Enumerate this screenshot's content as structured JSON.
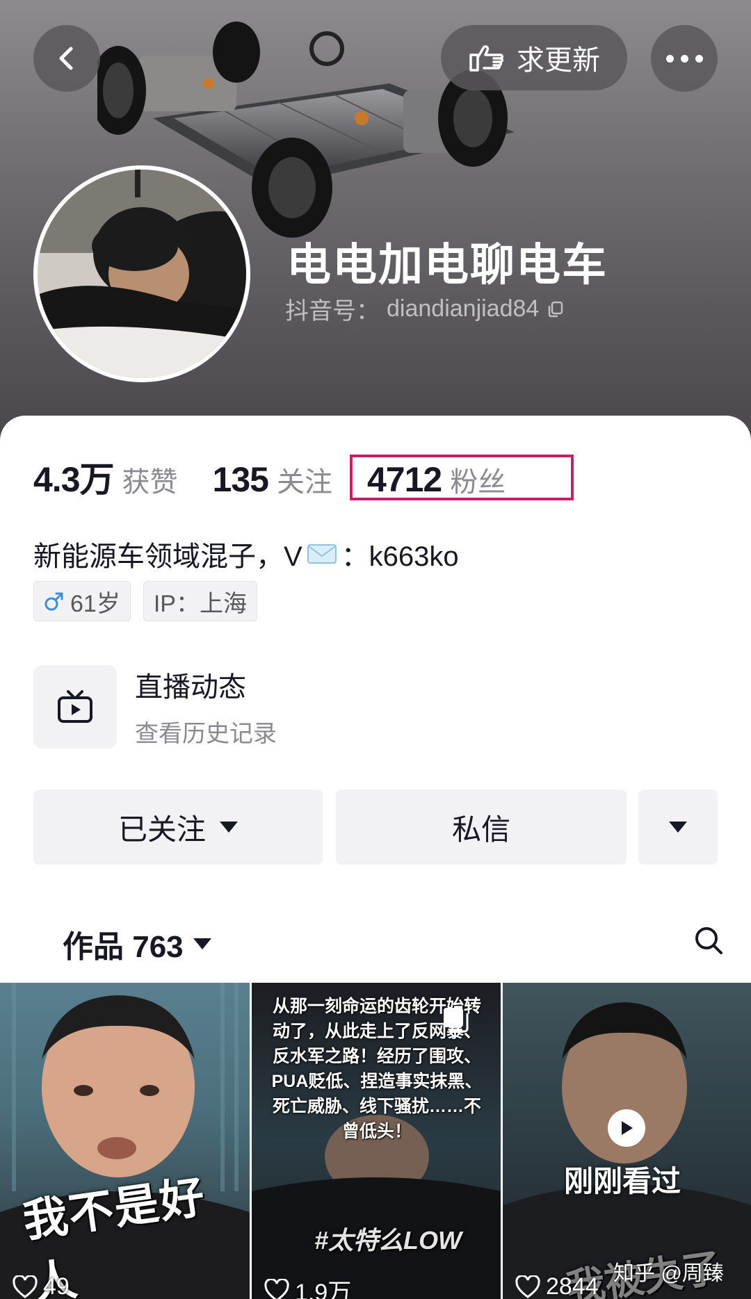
{
  "header": {
    "request_update_label": "求更新",
    "name": "电电加电聊电车",
    "douyin_id_label": "抖音号：",
    "douyin_id": "diandianjiad84"
  },
  "stats": [
    {
      "value": "4.3万",
      "label": "获赞"
    },
    {
      "value": "135",
      "label": "关注"
    },
    {
      "value": "4712",
      "label": "粉丝"
    }
  ],
  "highlight_color": "#c81e6e",
  "bio": {
    "text_before": "新能源车领域混子，V",
    "text_after": "：k663ko"
  },
  "tags": {
    "age": "61岁",
    "ip": "IP：上海"
  },
  "live": {
    "title": "直播动态",
    "subtitle": "查看历史记录"
  },
  "actions": {
    "follow_label": "已关注",
    "message_label": "私信"
  },
  "works": {
    "label": "作品 763"
  },
  "videos": [
    {
      "caption": "我不是好人",
      "likes": "49"
    },
    {
      "caption": "从那一刻命运的齿轮开始转动了，从此走上了反网暴、反水军之路！经历了围攻、PUA贬低、捏造事实抹黑、死亡威胁、线下骚扰……不曾低头！",
      "hashtag": "#太特么LOW",
      "likes": "1.9万"
    },
    {
      "caption": "我被失了",
      "badge": "刚刚看过",
      "likes": "2844"
    }
  ],
  "watermark": "知乎 @周臻"
}
